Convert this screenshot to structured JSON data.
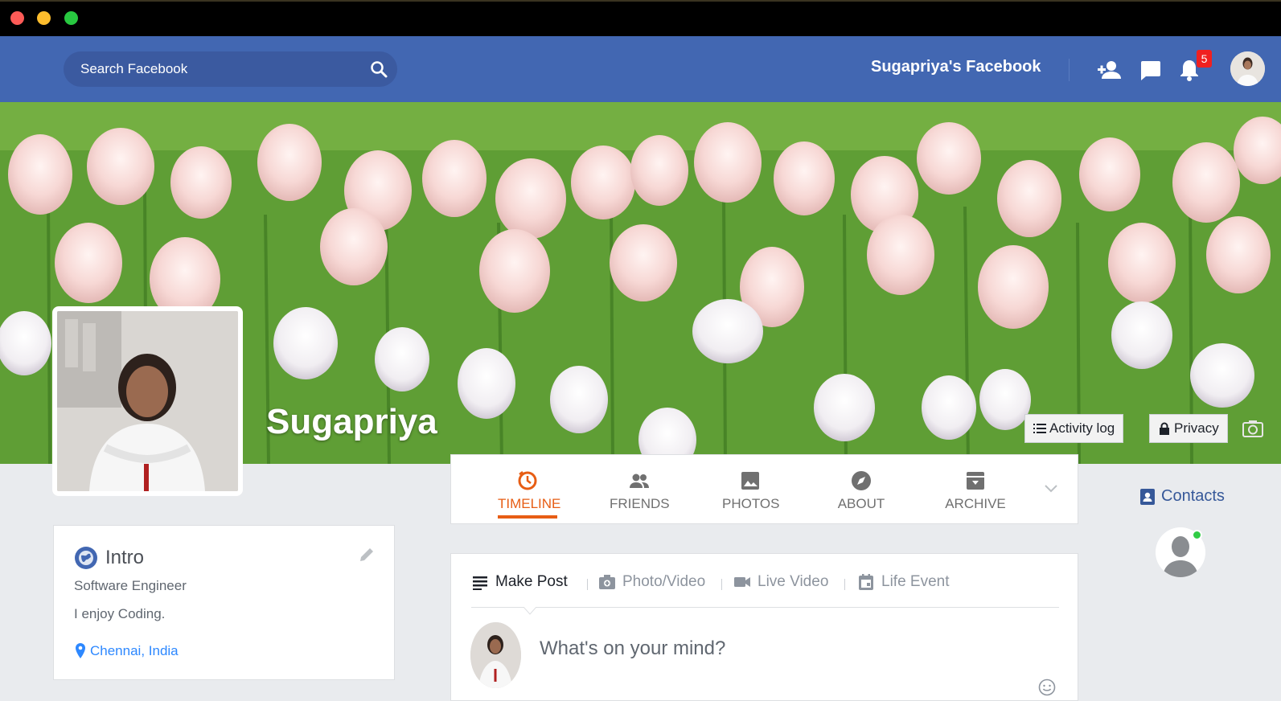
{
  "window": {
    "buttons": [
      "close",
      "minimize",
      "maximize"
    ]
  },
  "navbar": {
    "search_placeholder": "Search Facebook",
    "title": "Sugapriya's Facebook",
    "notification_count": "5",
    "icons": [
      "add-friend-icon",
      "messages-icon",
      "notifications-icon"
    ],
    "brand_color": "#4267b2"
  },
  "profile": {
    "name": "Sugapriya",
    "activity_log_label": "Activity log",
    "privacy_label": "Privacy"
  },
  "tabs": [
    {
      "label": "TIMELINE",
      "active": true
    },
    {
      "label": "FRIENDS",
      "active": false
    },
    {
      "label": "PHOTOS",
      "active": false
    },
    {
      "label": "ABOUT",
      "active": false
    },
    {
      "label": "ARCHIVE",
      "active": false
    }
  ],
  "intro": {
    "title": "Intro",
    "lines": [
      "Software Engineer",
      "I enjoy Coding."
    ],
    "location": "Chennai, India"
  },
  "composer": {
    "tabs": [
      "Make Post",
      "Photo/Video",
      "Live Video",
      "Life Event"
    ],
    "placeholder": "What's on your mind?"
  },
  "contacts": {
    "label": "Contacts",
    "online": true
  },
  "colors": {
    "accent": "#e75d14",
    "link": "#2d88ff"
  }
}
